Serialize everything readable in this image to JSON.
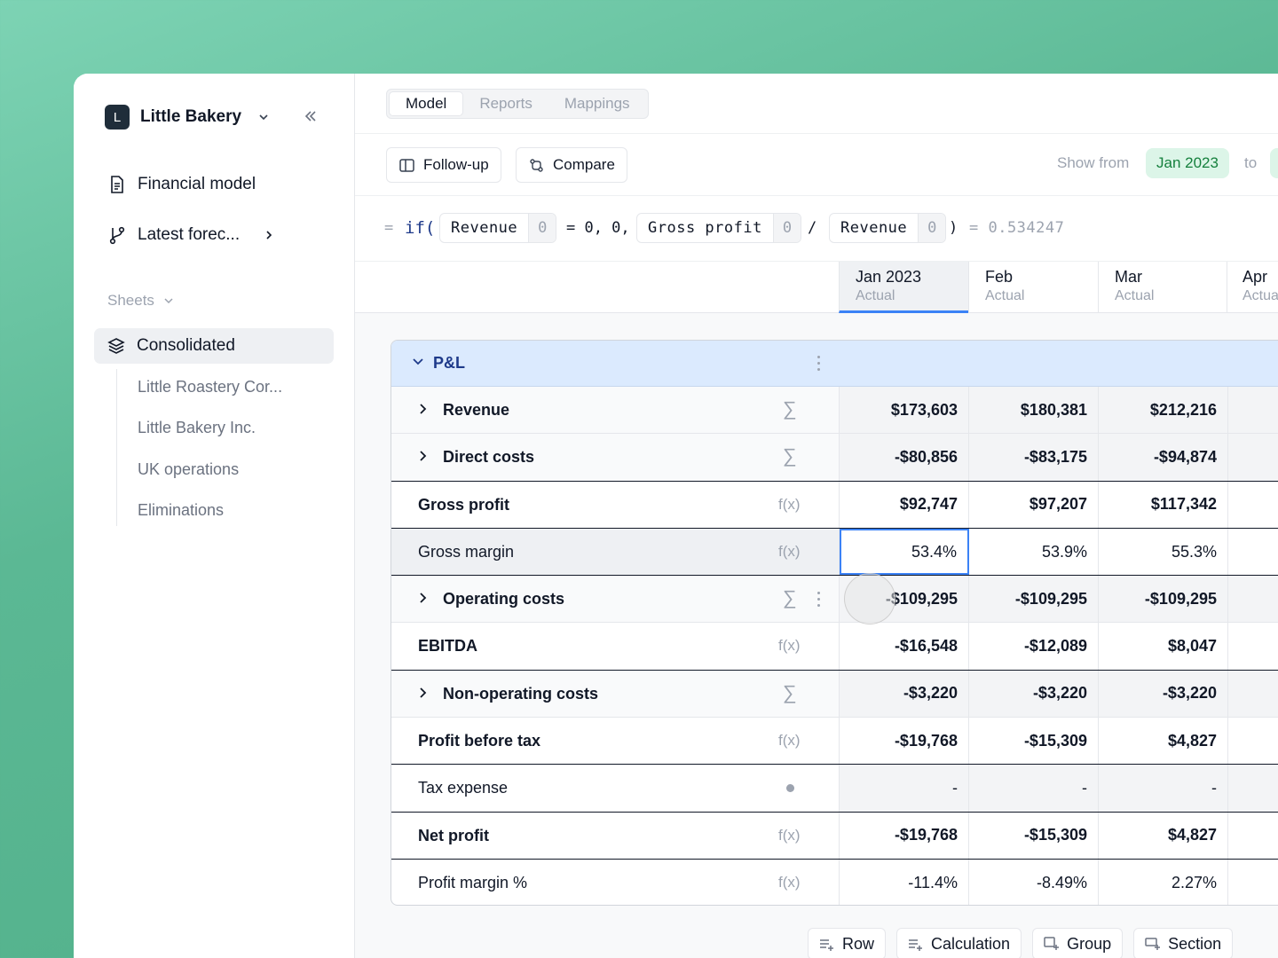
{
  "sidebar": {
    "org_initial": "L",
    "org_name": "Little Bakery",
    "nav": [
      {
        "label": "Financial model",
        "icon": "document-icon"
      },
      {
        "label": "Latest forec...",
        "icon": "branch-icon"
      }
    ],
    "sheets_label": "Sheets",
    "active_sheet": "Consolidated",
    "children": [
      "Little Roastery Cor...",
      "Little Bakery Inc.",
      "UK operations",
      "Eliminations"
    ]
  },
  "tabs": [
    "Model",
    "Reports",
    "Mappings"
  ],
  "toolbar": {
    "followup": "Follow-up",
    "compare": "Compare",
    "show_from": "Show from",
    "from_value": "Jan 2023",
    "to": "to"
  },
  "formula": {
    "eq": "=",
    "if": "if(",
    "ref1_name": "Revenue",
    "ref1_val": "0",
    "op1": "= 0, 0,",
    "ref2_name": "Gross profit",
    "ref2_val": "0",
    "op2": "/",
    "ref3_name": "Revenue",
    "ref3_val": "0",
    "close": ")",
    "result": "= 0.534247"
  },
  "columns": [
    {
      "month": "Jan 2023",
      "type": "Actual"
    },
    {
      "month": "Feb",
      "type": "Actual"
    },
    {
      "month": "Mar",
      "type": "Actual"
    },
    {
      "month": "Apr",
      "type": "Actua"
    }
  ],
  "group": {
    "label": "P&L"
  },
  "rows": [
    {
      "label": "Revenue",
      "kind": "sum",
      "values": [
        "$173,603",
        "$180,381",
        "$212,216",
        "$"
      ]
    },
    {
      "label": "Direct costs",
      "kind": "sum",
      "values": [
        "-$80,856",
        "-$83,175",
        "-$94,874",
        "-"
      ]
    },
    {
      "label": "Gross profit",
      "kind": "fx",
      "icon_text": "f(x)",
      "values": [
        "$92,747",
        "$97,207",
        "$117,342",
        ""
      ]
    },
    {
      "label": "Gross margin",
      "kind": "fx",
      "icon_text": "f(x)",
      "values": [
        "53.4%",
        "53.9%",
        "55.3%",
        ""
      ]
    },
    {
      "label": "Operating costs",
      "kind": "sum",
      "values": [
        "-$109,295",
        "-$109,295",
        "-$109,295",
        "-"
      ]
    },
    {
      "label": "EBITDA",
      "kind": "fx",
      "icon_text": "f(x)",
      "values": [
        "-$16,548",
        "-$12,089",
        "$8,047",
        ""
      ]
    },
    {
      "label": "Non-operating costs",
      "kind": "sum",
      "values": [
        "-$3,220",
        "-$3,220",
        "-$3,220",
        ""
      ]
    },
    {
      "label": "Profit before tax",
      "kind": "fx",
      "icon_text": "f(x)",
      "values": [
        "-$19,768",
        "-$15,309",
        "$4,827",
        ""
      ]
    },
    {
      "label": "Tax expense",
      "kind": "input",
      "values": [
        "-",
        "-",
        "-",
        ""
      ]
    },
    {
      "label": "Net profit",
      "kind": "fx",
      "icon_text": "f(x)",
      "values": [
        "-$19,768",
        "-$15,309",
        "$4,827",
        ""
      ]
    },
    {
      "label": "Profit margin %",
      "kind": "fx",
      "icon_text": "f(x)",
      "values": [
        "-11.4%",
        "-8.49%",
        "2.27%",
        ""
      ]
    }
  ],
  "add_buttons": [
    "Row",
    "Calculation",
    "Group",
    "Section"
  ],
  "colors": {
    "accent": "#3b82f6",
    "group_bg": "#dbeafe",
    "pill_bg": "#dcf5e8",
    "pill_text": "#15803d"
  }
}
